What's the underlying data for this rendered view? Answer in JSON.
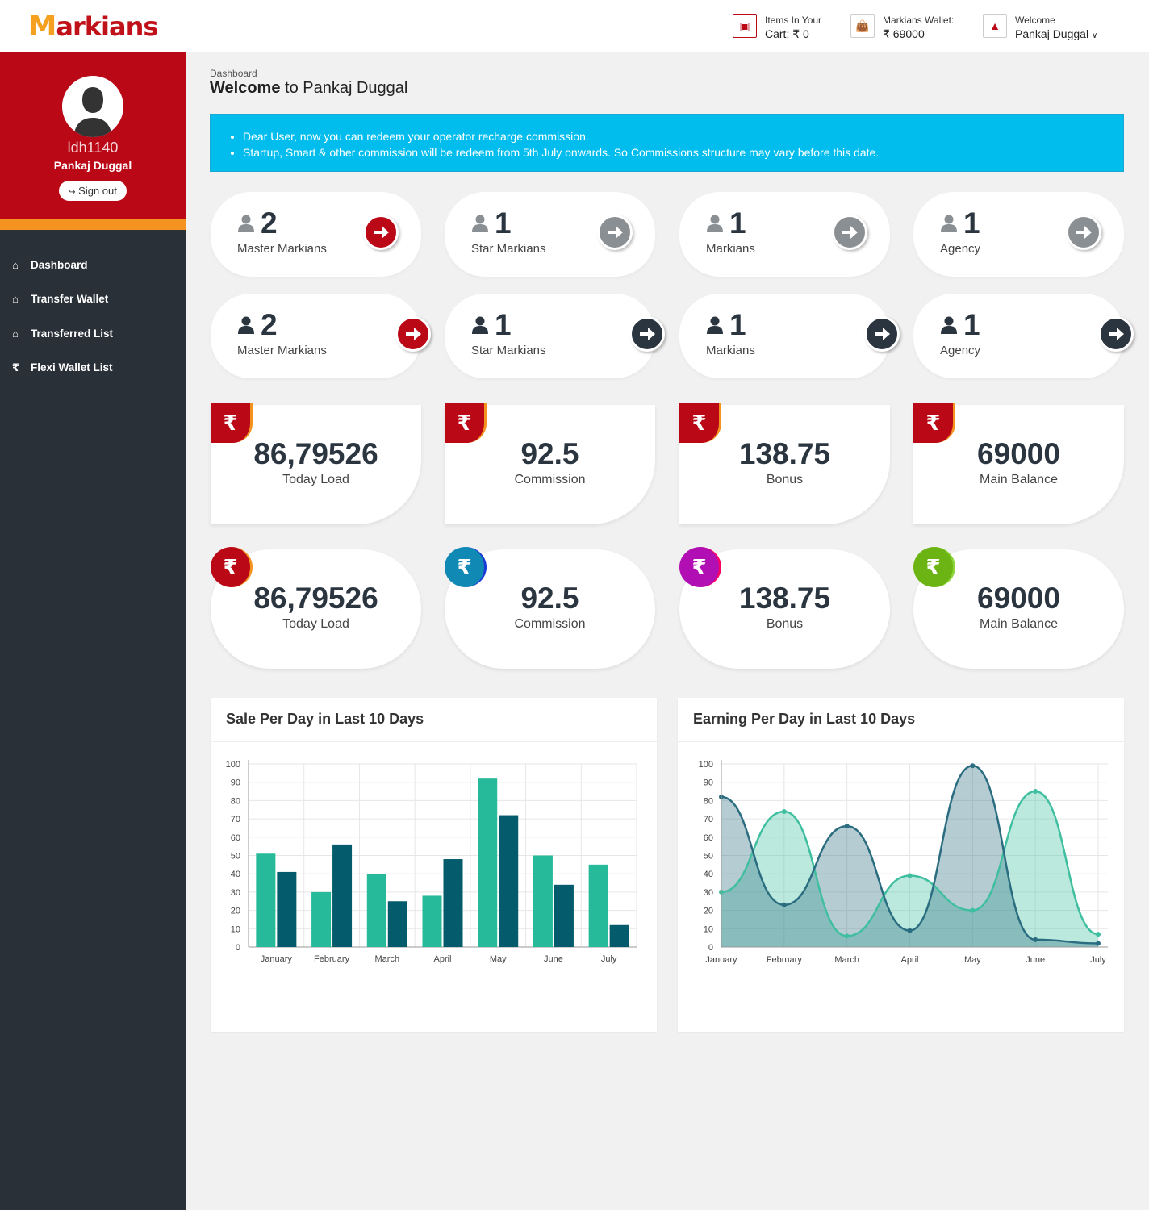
{
  "brand": {
    "name": "Markians"
  },
  "topbar": {
    "cart_label": "Items In Your",
    "cart_value": "Cart: ₹ 0",
    "wallet_label": "Markians Wallet:",
    "wallet_value": "₹ 69000",
    "welcome_label": "Welcome",
    "welcome_user": "Pankaj Duggal"
  },
  "profile": {
    "id": "ldh1140",
    "name": "Pankaj Duggal",
    "signout": "Sign out"
  },
  "menu": [
    {
      "label": "Dashboard",
      "icon": "home-icon"
    },
    {
      "label": "Transfer Wallet",
      "icon": "home-icon"
    },
    {
      "label": "Transferred List",
      "icon": "home-icon"
    },
    {
      "label": "Flexi Wallet List",
      "icon": "rupee-icon"
    }
  ],
  "page": {
    "breadcrumb": "Dashboard",
    "welcome_bold": "Welcome",
    "welcome_rest": "to Pankaj Duggal"
  },
  "notice": [
    "Dear User, now you can redeem your operator recharge commission.",
    "Startup, Smart & other commission will be redeem from 5th July onwards. So Commissions structure may vary before this date."
  ],
  "counts_row1": [
    {
      "num": "2",
      "label": "Master Markians",
      "btn": "#bb0817"
    },
    {
      "num": "1",
      "label": "Star Markians",
      "btn": "#8a8f94"
    },
    {
      "num": "1",
      "label": "Markians",
      "btn": "#8a8f94"
    },
    {
      "num": "1",
      "label": "Agency",
      "btn": "#8a8f94"
    }
  ],
  "counts_row2": [
    {
      "num": "2",
      "label": "Master Markians",
      "btn": "#bb0817"
    },
    {
      "num": "1",
      "label": "Star Markians",
      "btn": "#2b3540"
    },
    {
      "num": "1",
      "label": "Markians",
      "btn": "#2b3540"
    },
    {
      "num": "1",
      "label": "Agency",
      "btn": "#2b3540"
    }
  ],
  "stats_row1": [
    {
      "value": "86,79526",
      "label": "Today Load",
      "color": "#bb0817"
    },
    {
      "value": "92.5",
      "label": "Commission",
      "color": "#bb0817"
    },
    {
      "value": "138.75",
      "label": "Bonus",
      "color": "#bb0817"
    },
    {
      "value": "69000",
      "label": "Main Balance",
      "color": "#bb0817"
    }
  ],
  "stats_row2": [
    {
      "value": "86,79526",
      "label": "Today Load",
      "color": "#bb0817"
    },
    {
      "value": "92.5",
      "label": "Commission",
      "color": "#1089b5"
    },
    {
      "value": "138.75",
      "label": "Bonus",
      "color": "#b10fb3"
    },
    {
      "value": "69000",
      "label": "Main Balance",
      "color": "#6cb413"
    }
  ],
  "chart_data": [
    {
      "type": "bar",
      "title": "Sale Per Day in Last 10 Days",
      "categories": [
        "January",
        "February",
        "March",
        "April",
        "May",
        "June",
        "July"
      ],
      "ylim": [
        0,
        100
      ],
      "yticks": [
        0,
        10,
        20,
        30,
        40,
        50,
        60,
        70,
        80,
        90,
        100
      ],
      "grid": true,
      "colors": [
        "#26b99a",
        "#035b6b"
      ],
      "series": [
        {
          "values": [
            51,
            30,
            40,
            28,
            92,
            50,
            45
          ]
        },
        {
          "values": [
            41,
            56,
            25,
            48,
            72,
            34,
            12
          ]
        }
      ]
    },
    {
      "type": "area",
      "title": "Earning Per Day in Last 10 Days",
      "categories": [
        "January",
        "February",
        "March",
        "April",
        "May",
        "June",
        "July"
      ],
      "ylim": [
        0,
        100
      ],
      "yticks": [
        0,
        10,
        20,
        30,
        40,
        50,
        60,
        70,
        80,
        90,
        100
      ],
      "grid": true,
      "colors": [
        "#3fbfa0",
        "#2b6d80"
      ],
      "series": [
        {
          "values": [
            30,
            74,
            6,
            39,
            20,
            85,
            7
          ]
        },
        {
          "values": [
            82,
            23,
            66,
            9,
            99,
            4,
            2
          ]
        }
      ]
    }
  ]
}
